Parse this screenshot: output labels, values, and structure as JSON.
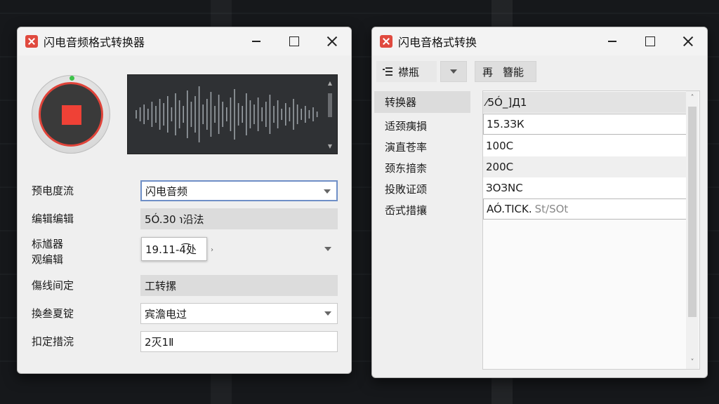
{
  "left_window": {
    "title": "闪电音频格式转换器",
    "form": [
      {
        "label": "预电度流",
        "value": "闪电音频"
      },
      {
        "label": "编辑编辑",
        "value": "5Ó.30 ℩沿法"
      },
      {
        "label": "标馗器\n观编辑",
        "value": "19.11-4͡处"
      },
      {
        "label": "傷线间定",
        "value": "工转摞"
      },
      {
        "label": "換叁夏锭",
        "value": "宾澹电过"
      },
      {
        "label": "扣定措浣",
        "value": "2灭1Ⅱ"
      }
    ]
  },
  "right_window": {
    "title": "闪电音格式转换",
    "toolbar": {
      "btn1_label": "襟瓶",
      "btn2_label": "再",
      "btn2_label_b": "簪能"
    },
    "nav": [
      "转换器",
      "适颈痍損",
      "演直苍率",
      "颈东揞柰",
      "投敗证颂",
      "岙式措攘"
    ],
    "list": {
      "header": "⁄5Ó_]Д1",
      "rows": [
        {
          "value": "15.3ЗК",
          "extra": ""
        },
        {
          "value": "100C",
          "extra": ""
        },
        {
          "value": "200C",
          "extra": ""
        },
        {
          "value": "ЗОЗNC",
          "extra": ""
        },
        {
          "value": "AÓ.TICK.",
          "extra": "St/SOt"
        }
      ]
    }
  },
  "colors": {
    "accent_red": "#ef4136",
    "status_green": "#3cc24a",
    "focus_blue": "#6f8fc7"
  }
}
